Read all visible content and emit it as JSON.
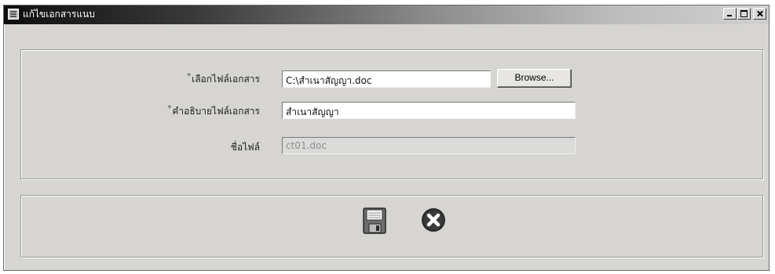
{
  "window": {
    "title": "แก้ไขเอกสารแนบ",
    "icon": "form-icon",
    "controls": [
      "minimize-icon",
      "maximize-icon",
      "close-icon"
    ]
  },
  "form": {
    "file_select": {
      "required_mark": "*",
      "label": "เลือกไฟล์เอกสาร",
      "value": "C:\\สำเนาสัญญา.doc",
      "browse_label": "Browse..."
    },
    "description": {
      "required_mark": "*",
      "label": "คำอธิบายไฟล์เอกสาร",
      "value": "สำเนาสัญญา"
    },
    "file_name": {
      "label": "ชื่อไฟล์",
      "value": "ct01.doc"
    }
  },
  "actions": {
    "save_icon": "save-disk-icon",
    "cancel_icon": "cancel-x-icon"
  }
}
